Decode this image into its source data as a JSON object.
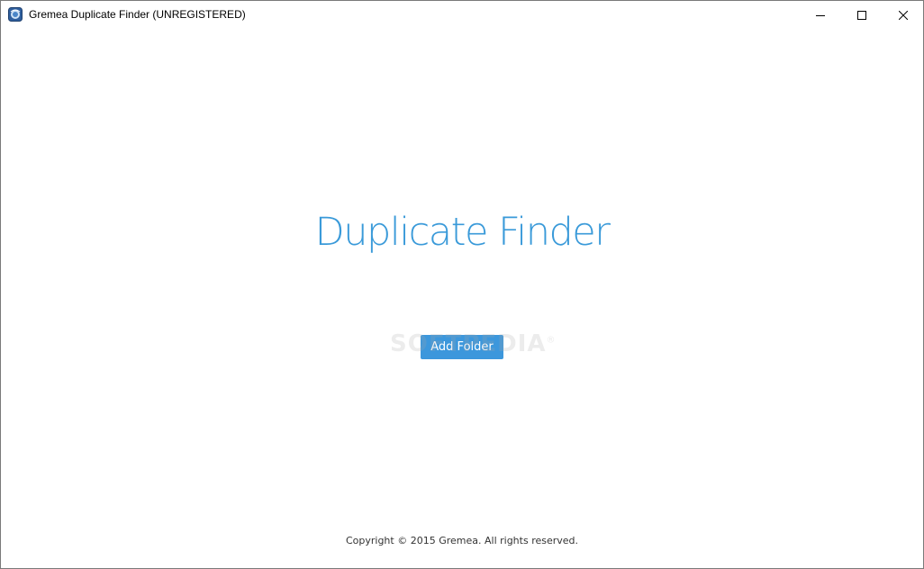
{
  "window": {
    "title": "Gremea Duplicate Finder (UNREGISTERED)",
    "controls": {
      "minimize_icon": "minimize-icon",
      "maximize_icon": "maximize-icon",
      "close_icon": "close-icon"
    }
  },
  "main": {
    "heading": "Duplicate Finder",
    "add_folder_label": "Add Folder"
  },
  "watermark": {
    "text": "SOFTPEDIA",
    "mark": "®"
  },
  "footer": {
    "copyright": "Copyright © 2015 Gremea. All rights reserved."
  },
  "colors": {
    "accent": "#3a9ad9",
    "button": "#3c97dc"
  }
}
